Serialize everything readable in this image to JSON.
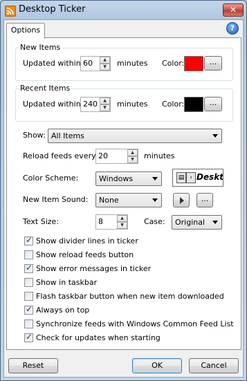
{
  "window": {
    "title": "Desktop Ticker",
    "close_label": "✕"
  },
  "tabs": [
    {
      "label": "Options",
      "active": true
    }
  ],
  "new_items": {
    "legend": "New Items",
    "updated_label": "Updated within",
    "value": "60",
    "unit": "minutes",
    "color_label": "Color:",
    "color": "#ff0000",
    "browse_label": "..."
  },
  "recent_items": {
    "legend": "Recent Items",
    "updated_label": "Updated within",
    "value": "240",
    "unit": "minutes",
    "color_label": "Color:",
    "color": "#000000",
    "browse_label": "..."
  },
  "show": {
    "label": "Show:",
    "value": "All Items"
  },
  "reload": {
    "label": "Reload feeds every",
    "value": "20",
    "unit": "minutes"
  },
  "color_scheme": {
    "label": "Color Scheme:",
    "value": "Windows",
    "preview_text": "Deskt"
  },
  "sound": {
    "label": "New Item Sound:",
    "value": "None",
    "browse_label": "..."
  },
  "text_size": {
    "label": "Text Size:",
    "value": "8"
  },
  "case": {
    "label": "Case:",
    "value": "Original"
  },
  "checkboxes": [
    {
      "label": "Show divider lines in ticker",
      "checked": true
    },
    {
      "label": "Show reload feeds button",
      "checked": false
    },
    {
      "label": "Show error messages in ticker",
      "checked": true
    },
    {
      "label": "Show in taskbar",
      "checked": false
    },
    {
      "label": "Flash taskbar button when new item downloaded",
      "checked": false
    },
    {
      "label": "Always on top",
      "checked": true
    },
    {
      "label": "Synchronize feeds with Windows Common Feed List",
      "checked": false
    },
    {
      "label": "Check for updates when starting",
      "checked": true
    }
  ],
  "buttons": {
    "reset": "Reset",
    "ok": "OK",
    "cancel": "Cancel"
  },
  "icons": {
    "app": "rss-icon",
    "help": "help-icon"
  }
}
